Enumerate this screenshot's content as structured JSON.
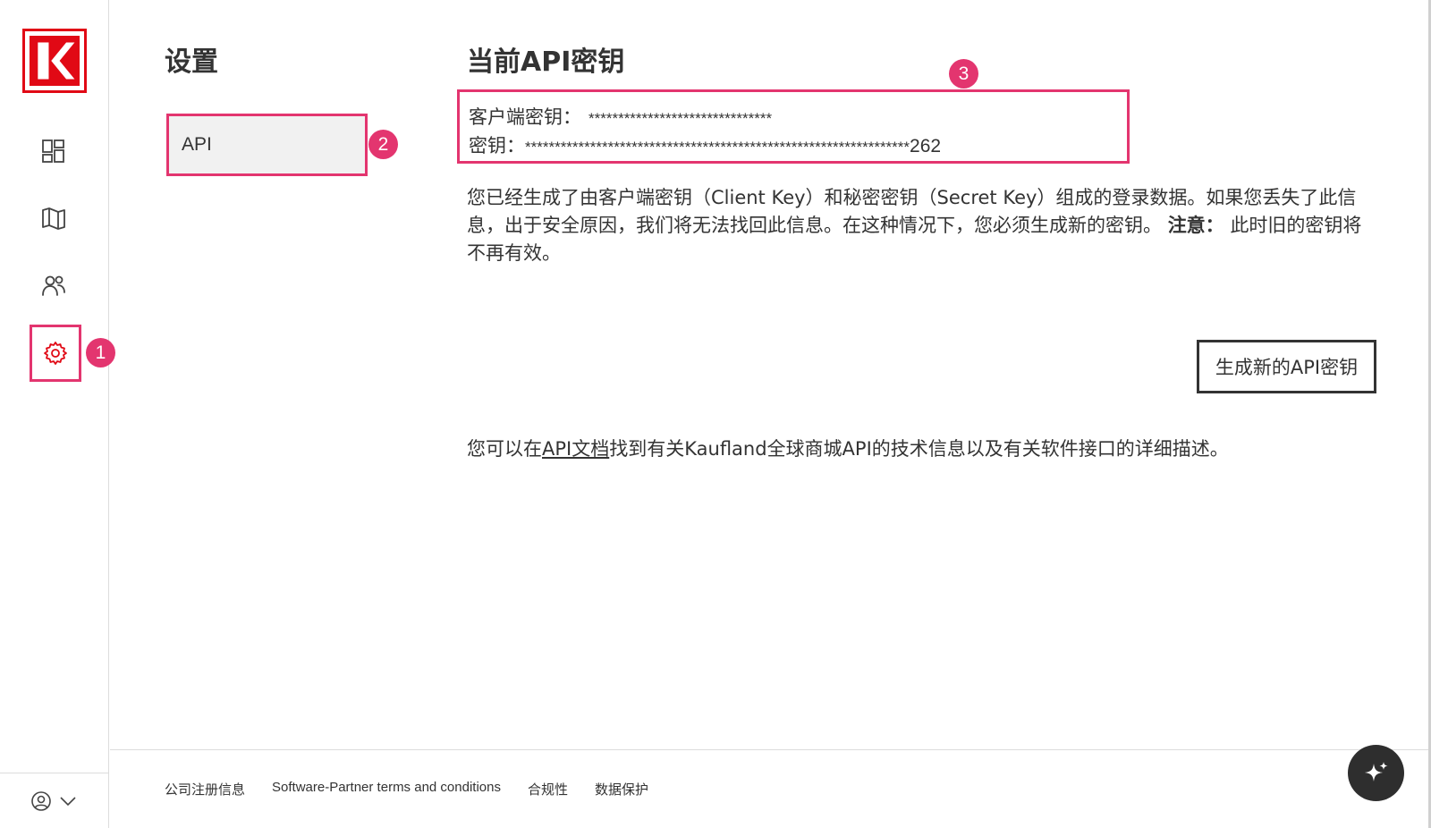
{
  "sidebar": {
    "logo_icon": "kaufland-k-logo",
    "nav": [
      "dashboard-icon",
      "map-icon",
      "users-icon",
      "settings-icon"
    ],
    "account_icon": "user-circle-icon"
  },
  "markers": {
    "m1": "1",
    "m2": "2",
    "m3": "3"
  },
  "settings": {
    "title": "设置",
    "subnav_api": "API"
  },
  "main": {
    "title": "当前API密钥",
    "client_key_label": "客户端密钥：",
    "client_key_value": "*******************************",
    "secret_key_label": "密钥：",
    "secret_key_value": "*****************************************************************",
    "secret_key_suffix": "262",
    "desc_part1": "您已经生成了由客户端密钥（Client Key）和秘密密钥（Secret Key）组成的登录数据。如果您丢失了此信息，出于安全原因，我们将无法找回此信息。在这种情况下，您必须生成新的密钥。",
    "desc_note": "注意：",
    "desc_part2": "此时旧的密钥将不再有效。",
    "generate_button": "生成新的API密钥",
    "info_before": "您可以在",
    "info_link": "API文档",
    "info_after": "找到有关Kaufland全球商城API的技术信息以及有关软件接口的详细描述。"
  },
  "footer": {
    "links": [
      "公司注册信息",
      "Software-Partner terms and conditions",
      "合规性",
      "数据保护"
    ]
  },
  "colors": {
    "accent": "#e3356f",
    "brand": "#e10915",
    "dark": "#2e2e2e"
  }
}
